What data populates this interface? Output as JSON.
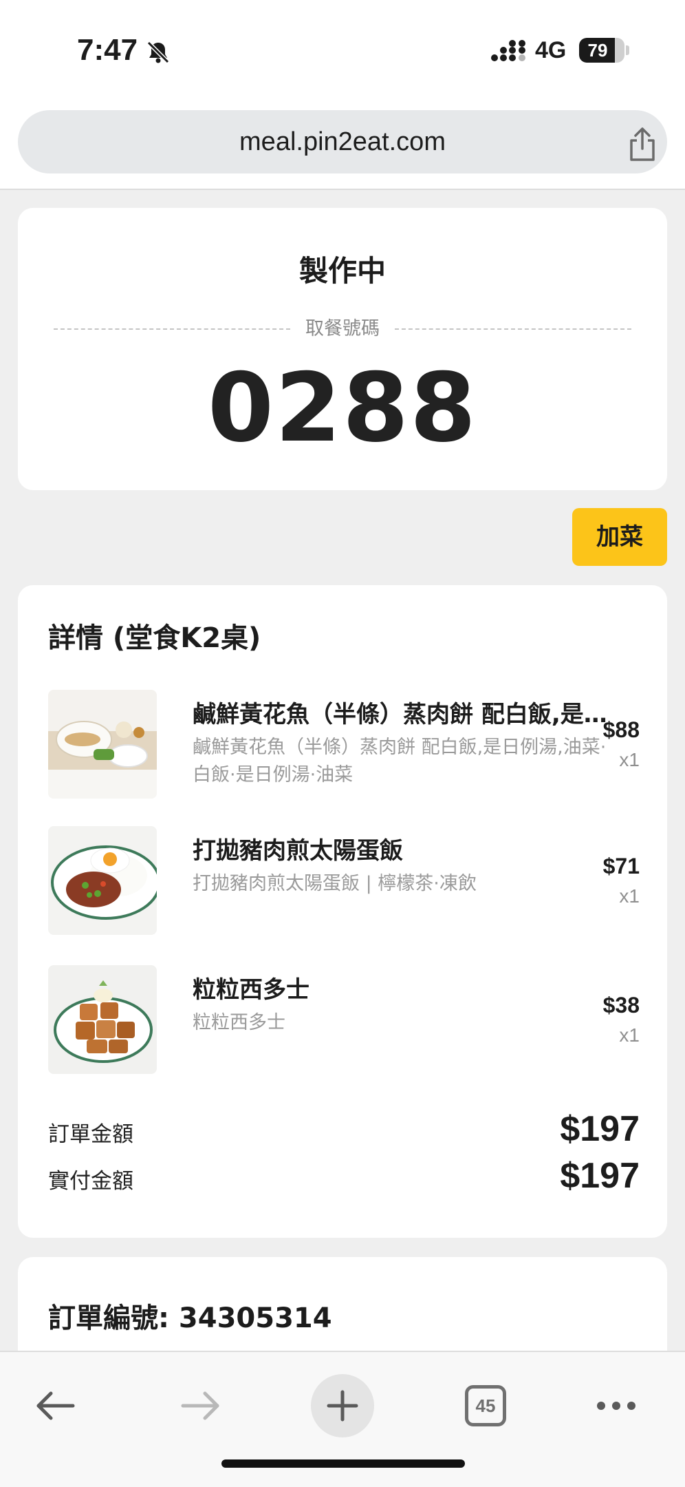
{
  "status_bar": {
    "time": "7:47",
    "network": "4G",
    "battery_percent": "79",
    "battery_level": 0.79
  },
  "browser": {
    "url": "meal.pin2eat.com",
    "tabs_count": "45"
  },
  "order_status": {
    "title": "製作中",
    "pickup_label": "取餐號碼",
    "pickup_number": "0288"
  },
  "add_dish_label": "加菜",
  "details": {
    "title": "詳情 (堂食K2桌)",
    "items": [
      {
        "name": "鹹鮮黃花魚（半條）蒸肉餅 配白飯,是日例湯,油菜·白飯·是日例湯·油菜",
        "desc": "鹹鮮黃花魚（半條）蒸肉餅 配白飯,是日例湯,油菜·白飯·是日例湯·油菜",
        "price": "$88",
        "qty": "x1"
      },
      {
        "name": "打拋豬肉煎太陽蛋飯",
        "desc": "打拋豬肉煎太陽蛋飯 | 檸檬茶·凍飲",
        "price": "$71",
        "qty": "x1"
      },
      {
        "name": "粒粒西多士",
        "desc": "粒粒西多士",
        "price": "$38",
        "qty": "x1"
      }
    ],
    "order_amount_label": "訂單金額",
    "order_amount": "$197",
    "paid_amount_label": "實付金額",
    "paid_amount": "$197"
  },
  "order_info": {
    "order_number_text": "訂單編號: 34305314"
  },
  "colors": {
    "accent": "#fcc419",
    "page_bg": "#efefef"
  }
}
